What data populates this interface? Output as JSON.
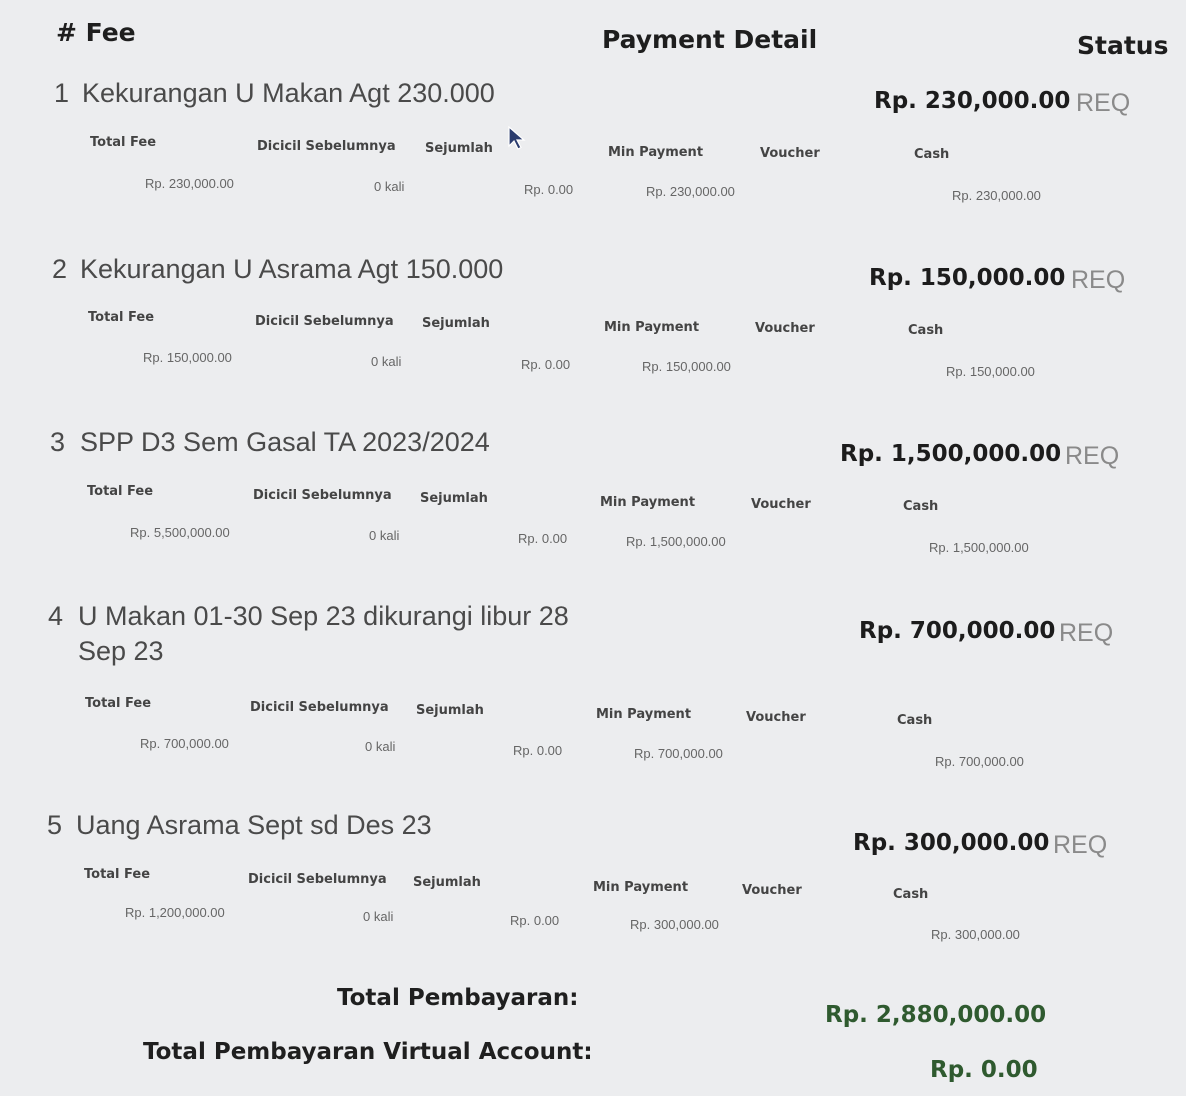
{
  "header": {
    "fee_label": "# Fee",
    "detail_label": "Payment Detail",
    "status_label": "Status"
  },
  "columns": {
    "total_fee": "Total Fee",
    "dicicil": "Dicicil Sebelumnya",
    "sejumlah": "Sejumlah",
    "min_payment": "Min Payment",
    "voucher": "Voucher",
    "cash": "Cash"
  },
  "fees": [
    {
      "number": "1",
      "title": "Kekurangan U Makan Agt 230.000",
      "title_line2": "",
      "amount": "Rp. 230,000.00",
      "status": "REQ",
      "total_fee": "Rp. 230,000.00",
      "dicicil": "0 kali",
      "sejumlah": "Rp. 0.00",
      "min_payment": "Rp. 230,000.00",
      "cash": "Rp. 230,000.00"
    },
    {
      "number": "2",
      "title": "Kekurangan U Asrama Agt 150.000",
      "title_line2": "",
      "amount": "Rp. 150,000.00",
      "status": "REQ",
      "total_fee": "Rp. 150,000.00",
      "dicicil": "0 kali",
      "sejumlah": "Rp. 0.00",
      "min_payment": "Rp. 150,000.00",
      "cash": "Rp. 150,000.00"
    },
    {
      "number": "3",
      "title": "SPP D3 Sem Gasal TA 2023/2024",
      "title_line2": "",
      "amount": "Rp. 1,500,000.00",
      "status": "REQ",
      "total_fee": "Rp. 5,500,000.00",
      "dicicil": "0 kali",
      "sejumlah": "Rp. 0.00",
      "min_payment": "Rp. 1,500,000.00",
      "cash": "Rp. 1,500,000.00"
    },
    {
      "number": "4",
      "title": "U Makan 01-30 Sep 23 dikurangi libur 28",
      "title_line2": "Sep 23",
      "amount": "Rp. 700,000.00",
      "status": "REQ",
      "total_fee": "Rp. 700,000.00",
      "dicicil": "0 kali",
      "sejumlah": "Rp. 0.00",
      "min_payment": "Rp. 700,000.00",
      "cash": "Rp. 700,000.00"
    },
    {
      "number": "5",
      "title": "Uang Asrama Sept sd Des 23",
      "title_line2": "",
      "amount": "Rp. 300,000.00",
      "status": "REQ",
      "total_fee": "Rp. 1,200,000.00",
      "dicicil": "0 kali",
      "sejumlah": "Rp. 0.00",
      "min_payment": "Rp. 300,000.00",
      "cash": "Rp. 300,000.00"
    }
  ],
  "totals": {
    "total_label": "Total Pembayaran:",
    "total_value": "Rp. 2,880,000.00",
    "va_label": "Total Pembayaran Virtual Account:",
    "va_value": "Rp. 0.00"
  },
  "colors": {
    "background": "#ecedef",
    "total_value": "#2f5a2f",
    "status": "#8a8a8a"
  },
  "icons": {
    "cursor": "mouse-pointer-icon"
  }
}
